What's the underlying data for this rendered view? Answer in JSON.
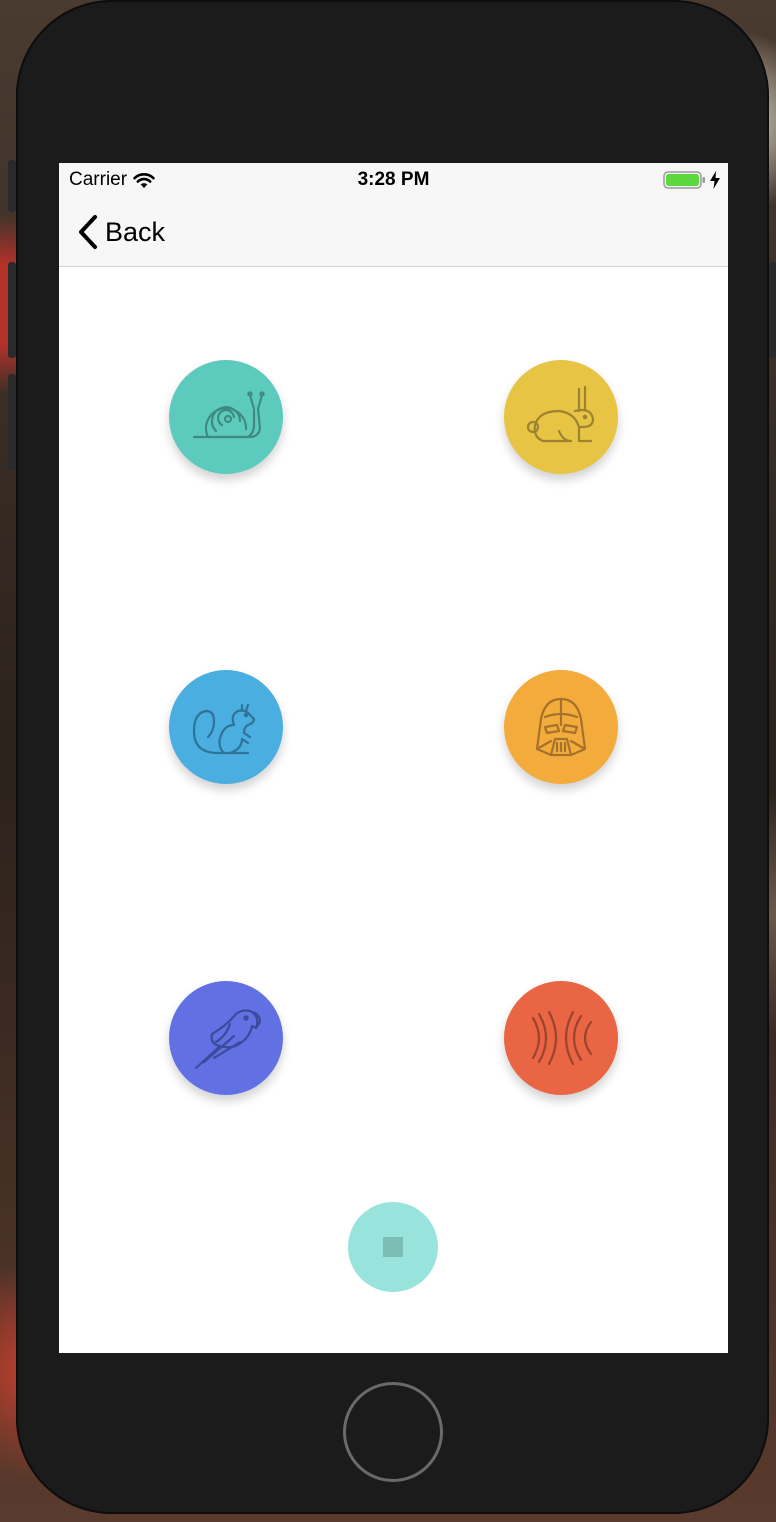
{
  "status_bar": {
    "carrier": "Carrier",
    "time": "3:28 PM",
    "battery_color": "#5cd83c"
  },
  "nav": {
    "back_label": "Back"
  },
  "buttons": [
    {
      "name": "snail",
      "icon": "snail-icon",
      "color": "#5ccbbd",
      "stroke": "#3f8a80"
    },
    {
      "name": "rabbit",
      "icon": "rabbit-icon",
      "color": "#e8c444",
      "stroke": "#9b8330"
    },
    {
      "name": "squirrel",
      "icon": "squirrel-icon",
      "color": "#4aaee0",
      "stroke": "#2f7399"
    },
    {
      "name": "darth-vader",
      "icon": "darth-vader-icon",
      "color": "#f3ab3c",
      "stroke": "#a4722a"
    },
    {
      "name": "parrot",
      "icon": "parrot-icon",
      "color": "#6171e3",
      "stroke": "#3d4a9a"
    },
    {
      "name": "echo",
      "icon": "echo-waves-icon",
      "color": "#e96544",
      "stroke": "#9c432e"
    }
  ],
  "stop_button": {
    "icon": "stop-icon",
    "color": "#98e4dc",
    "square_color": "#7bbdb5"
  }
}
